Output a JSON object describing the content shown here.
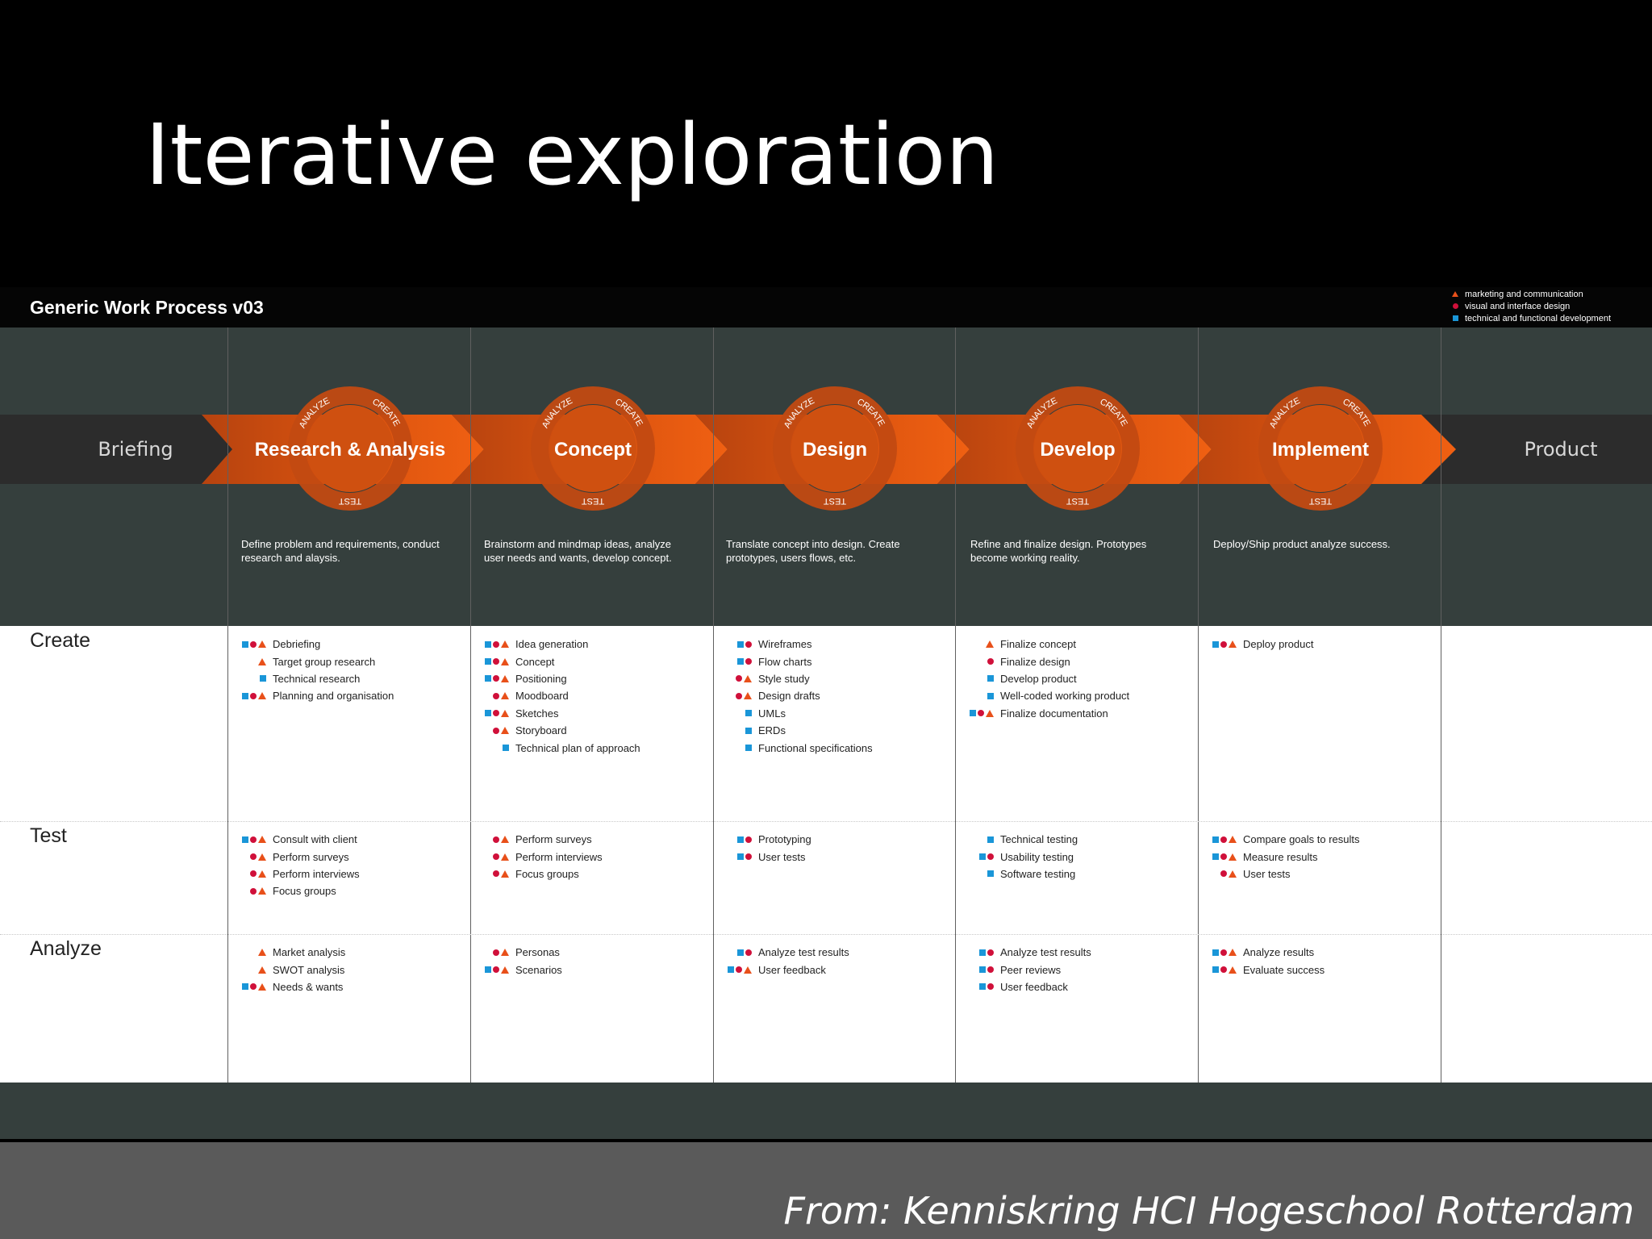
{
  "slide_title": "Iterative exploration",
  "diagram": {
    "title": "Generic Work Process v03",
    "legend": [
      {
        "symbol": "triangle",
        "label": "marketing and communication",
        "color": "#e8501a"
      },
      {
        "symbol": "circle",
        "label": "visual and interface design",
        "color": "#d0103a"
      },
      {
        "symbol": "square",
        "label": "technical and functional development",
        "color": "#1a96d8"
      }
    ],
    "start_label": "Briefing",
    "end_label": "Product",
    "cycle_labels": {
      "analyze": "ANALYZE",
      "create": "CREATE",
      "test": "TEST"
    },
    "phases": [
      {
        "name": "Research & Analysis",
        "description": "Define problem and requirements, conduct research and alaysis."
      },
      {
        "name": "Concept",
        "description": "Brainstorm and mindmap ideas, analyze user needs and wants, develop concept."
      },
      {
        "name": "Design",
        "description": "Translate concept into design. Create prototypes, users flows, etc."
      },
      {
        "name": "Develop",
        "description": "Refine and finalize design. Prototypes become working reality."
      },
      {
        "name": "Implement",
        "description": "Deploy/Ship product analyze success."
      }
    ],
    "rows": [
      {
        "label": "Create"
      },
      {
        "label": "Test"
      },
      {
        "label": "Analyze"
      }
    ],
    "activities": {
      "create": [
        [
          {
            "text": "Debriefing",
            "syms": "sct"
          },
          {
            "text": "Target group research",
            "syms": "t"
          },
          {
            "text": "Technical research",
            "syms": "s"
          },
          {
            "text": "Planning and organisation",
            "syms": "sct"
          }
        ],
        [
          {
            "text": "Idea generation",
            "syms": "sct"
          },
          {
            "text": "Concept",
            "syms": "sct"
          },
          {
            "text": "Positioning",
            "syms": "sct"
          },
          {
            "text": "Moodboard",
            "syms": "ct"
          },
          {
            "text": "Sketches",
            "syms": "sct"
          },
          {
            "text": "Storyboard",
            "syms": "ct"
          },
          {
            "text": "Technical plan of approach",
            "syms": "s"
          }
        ],
        [
          {
            "text": "Wireframes",
            "syms": "sc"
          },
          {
            "text": "Flow charts",
            "syms": "sc"
          },
          {
            "text": "Style study",
            "syms": "ct"
          },
          {
            "text": "Design drafts",
            "syms": "ct"
          },
          {
            "text": "UMLs",
            "syms": "s"
          },
          {
            "text": "ERDs",
            "syms": "s"
          },
          {
            "text": "Functional specifications",
            "syms": "s"
          }
        ],
        [
          {
            "text": "Finalize concept",
            "syms": "t"
          },
          {
            "text": "Finalize design",
            "syms": "c"
          },
          {
            "text": "Develop product",
            "syms": "s"
          },
          {
            "text": "Well-coded working product",
            "syms": "s"
          },
          {
            "text": "Finalize documentation",
            "syms": "sct"
          }
        ],
        [
          {
            "text": "Deploy product",
            "syms": "sct"
          }
        ]
      ],
      "test": [
        [
          {
            "text": "Consult with client",
            "syms": "sct"
          },
          {
            "text": "Perform surveys",
            "syms": "ct"
          },
          {
            "text": "Perform interviews",
            "syms": "ct"
          },
          {
            "text": "Focus groups",
            "syms": "ct"
          }
        ],
        [
          {
            "text": "Perform surveys",
            "syms": "ct"
          },
          {
            "text": "Perform interviews",
            "syms": "ct"
          },
          {
            "text": "Focus groups",
            "syms": "ct"
          }
        ],
        [
          {
            "text": "Prototyping",
            "syms": "sc"
          },
          {
            "text": "User tests",
            "syms": "sc"
          }
        ],
        [
          {
            "text": "Technical testing",
            "syms": "s"
          },
          {
            "text": "Usability testing",
            "syms": "sc"
          },
          {
            "text": "Software testing",
            "syms": "s"
          }
        ],
        [
          {
            "text": "Compare goals to results",
            "syms": "sct"
          },
          {
            "text": "Measure results",
            "syms": "sct"
          },
          {
            "text": "User tests",
            "syms": "ct"
          }
        ]
      ],
      "analyze": [
        [
          {
            "text": "Market analysis",
            "syms": "t"
          },
          {
            "text": "SWOT analysis",
            "syms": "t"
          },
          {
            "text": "Needs & wants",
            "syms": "sct"
          }
        ],
        [
          {
            "text": "Personas",
            "syms": "ct"
          },
          {
            "text": "Scenarios",
            "syms": "sct"
          }
        ],
        [
          {
            "text": "Analyze test results",
            "syms": "sc"
          },
          {
            "text": "User feedback",
            "syms": "sct"
          }
        ],
        [
          {
            "text": "Analyze test results",
            "syms": "sc"
          },
          {
            "text": "Peer reviews",
            "syms": "sc"
          },
          {
            "text": "User feedback",
            "syms": "sc"
          }
        ],
        [
          {
            "text": "Analyze results",
            "syms": "sct"
          },
          {
            "text": "Evaluate success",
            "syms": "sct"
          }
        ]
      ]
    }
  },
  "credit": "From: Kenniskring HCI Hogeschool Rotterdam"
}
